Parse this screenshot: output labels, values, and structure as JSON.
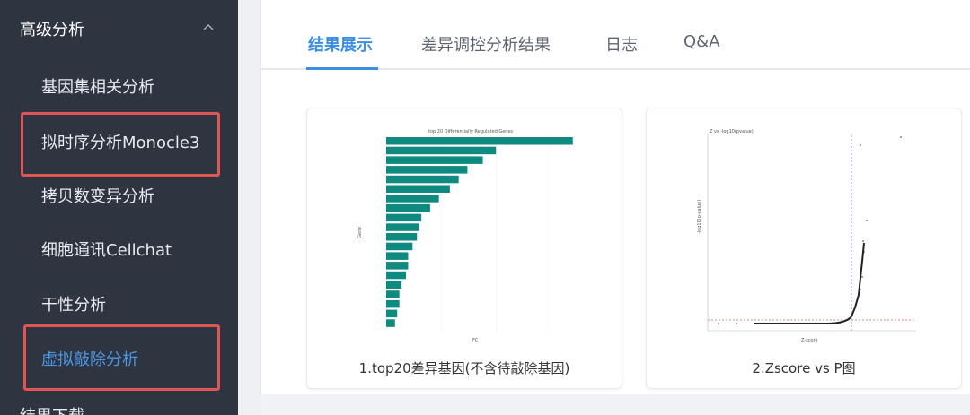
{
  "sidebar": {
    "section_title": "高级分析",
    "items": [
      {
        "label": "基因集相关分析"
      },
      {
        "label": "拟时序分析Monocle3"
      },
      {
        "label": "拷贝数变异分析"
      },
      {
        "label": "细胞通讯Cellchat"
      },
      {
        "label": "干性分析"
      },
      {
        "label": "虚拟敲除分析"
      }
    ],
    "next_section": "结果下载",
    "active_index": 5
  },
  "tabs": [
    {
      "label": "结果展示",
      "active": true
    },
    {
      "label": "差异调控分析结果",
      "active": false
    },
    {
      "label": "日志",
      "active": false
    },
    {
      "label": "Q&A",
      "active": false
    }
  ],
  "colors": {
    "accent": "#3a8ee6",
    "highlight_border": "#e05555",
    "bar": "#0e8a80",
    "sidebar_bg": "#2e3440"
  },
  "cards": [
    {
      "caption": "1.top20差异基因(不含待敲除基因)"
    },
    {
      "caption": "2.Zscore vs P图"
    }
  ],
  "chart_data": [
    {
      "type": "bar",
      "orientation": "horizontal",
      "title": "top 20 Differentially Regulated Genes",
      "xlabel": "FC",
      "ylabel": "Gene",
      "values": [
        0.85,
        0.5,
        0.44,
        0.37,
        0.33,
        0.29,
        0.24,
        0.2,
        0.16,
        0.15,
        0.14,
        0.12,
        0.1,
        0.1,
        0.09,
        0.07,
        0.06,
        0.06,
        0.05,
        0.04
      ],
      "bar_color": "#0e8a80"
    },
    {
      "type": "scatter",
      "title": "Z vs -log10(pvalue)",
      "xlabel": "Z-score",
      "ylabel": "-log10(p-value)"
    }
  ]
}
